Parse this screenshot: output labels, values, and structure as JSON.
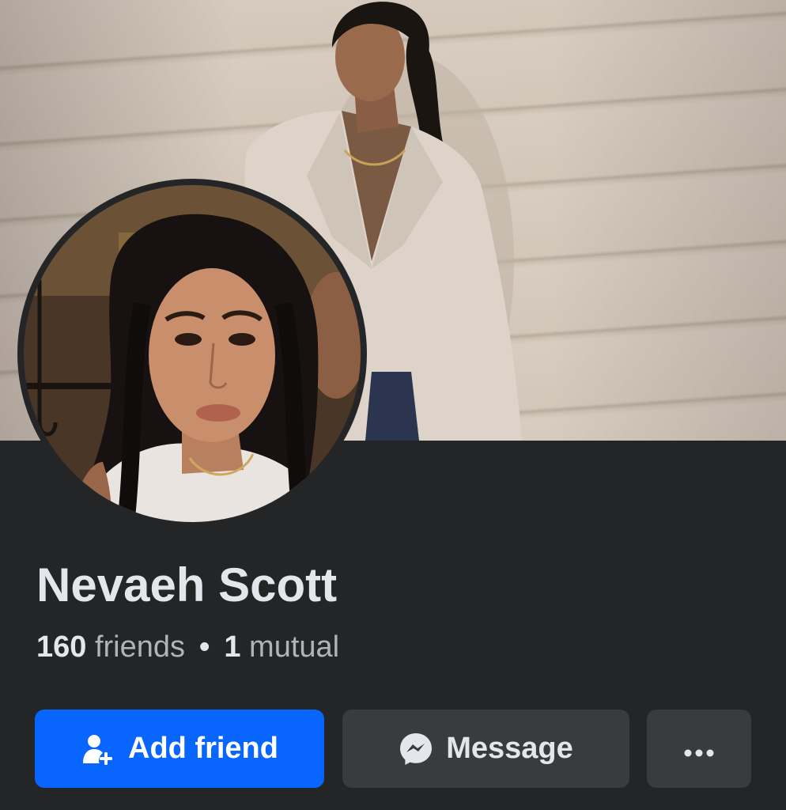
{
  "profile": {
    "name": "Nevaeh Scott",
    "friends_count": "160",
    "friends_label": "friends",
    "separator": "•",
    "mutual_count": "1",
    "mutual_label": "mutual"
  },
  "actions": {
    "add_friend_label": "Add friend",
    "add_friend_icon": "add-person-icon",
    "message_label": "Message",
    "message_icon": "messenger-icon",
    "more_label": "···",
    "more_icon": "more-options-icon"
  },
  "colors": {
    "background": "#242527",
    "primary_button": "#0866ff",
    "secondary_button": "#3a3b3c",
    "primary_text": "#e4e6eb",
    "secondary_text": "#b0b3b8"
  }
}
